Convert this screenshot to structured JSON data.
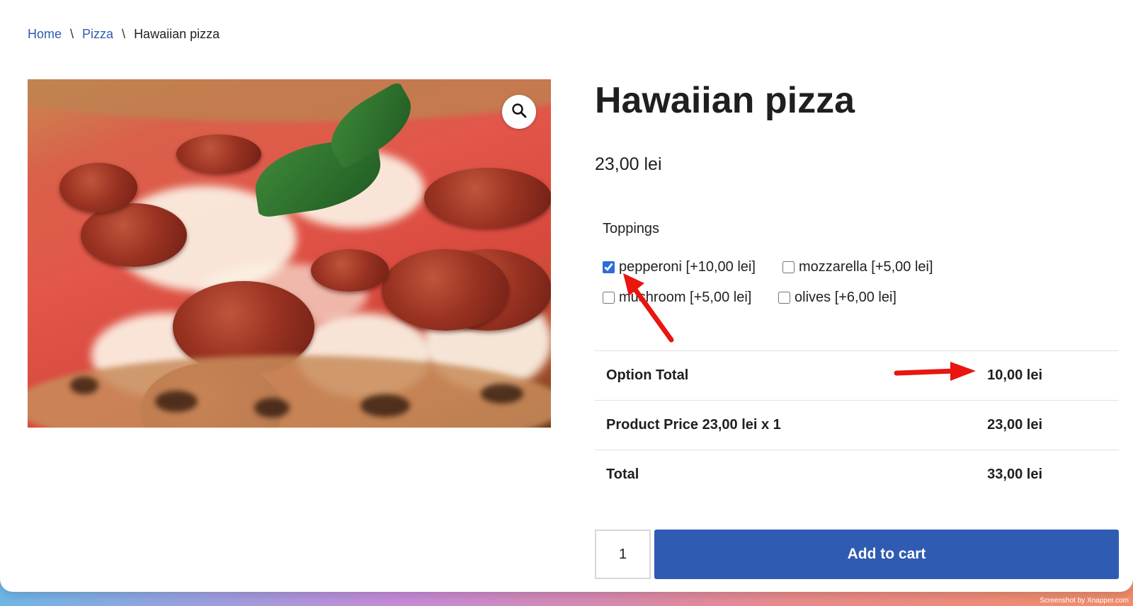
{
  "breadcrumb": {
    "home": "Home",
    "category": "Pizza",
    "current": "Hawaiian pizza",
    "separator": "\\"
  },
  "product": {
    "title": "Hawaiian pizza",
    "price": "23,00 lei",
    "image_icon": "zoom-icon"
  },
  "toppings": {
    "label": "Toppings",
    "options": [
      {
        "label": "pepperoni [+10,00 lei]",
        "checked": true
      },
      {
        "label": "mozzarella [+5,00 lei]",
        "checked": false
      },
      {
        "label": "mushroom [+5,00 lei]",
        "checked": false
      },
      {
        "label": "olives [+6,00 lei]",
        "checked": false
      }
    ]
  },
  "summary": {
    "rows": [
      {
        "label": "Option Total",
        "value": "10,00 lei"
      },
      {
        "label": "Product Price 23,00 lei x 1",
        "value": "23,00 lei"
      },
      {
        "label": "Total",
        "value": "33,00 lei"
      }
    ]
  },
  "cart": {
    "quantity": "1",
    "button_label": "Add to cart"
  },
  "colors": {
    "link": "#2f5bb3",
    "button": "#2f5bb3",
    "annotation_arrow": "#e8160f"
  },
  "watermark": "Screenshot by Xnapper.com"
}
